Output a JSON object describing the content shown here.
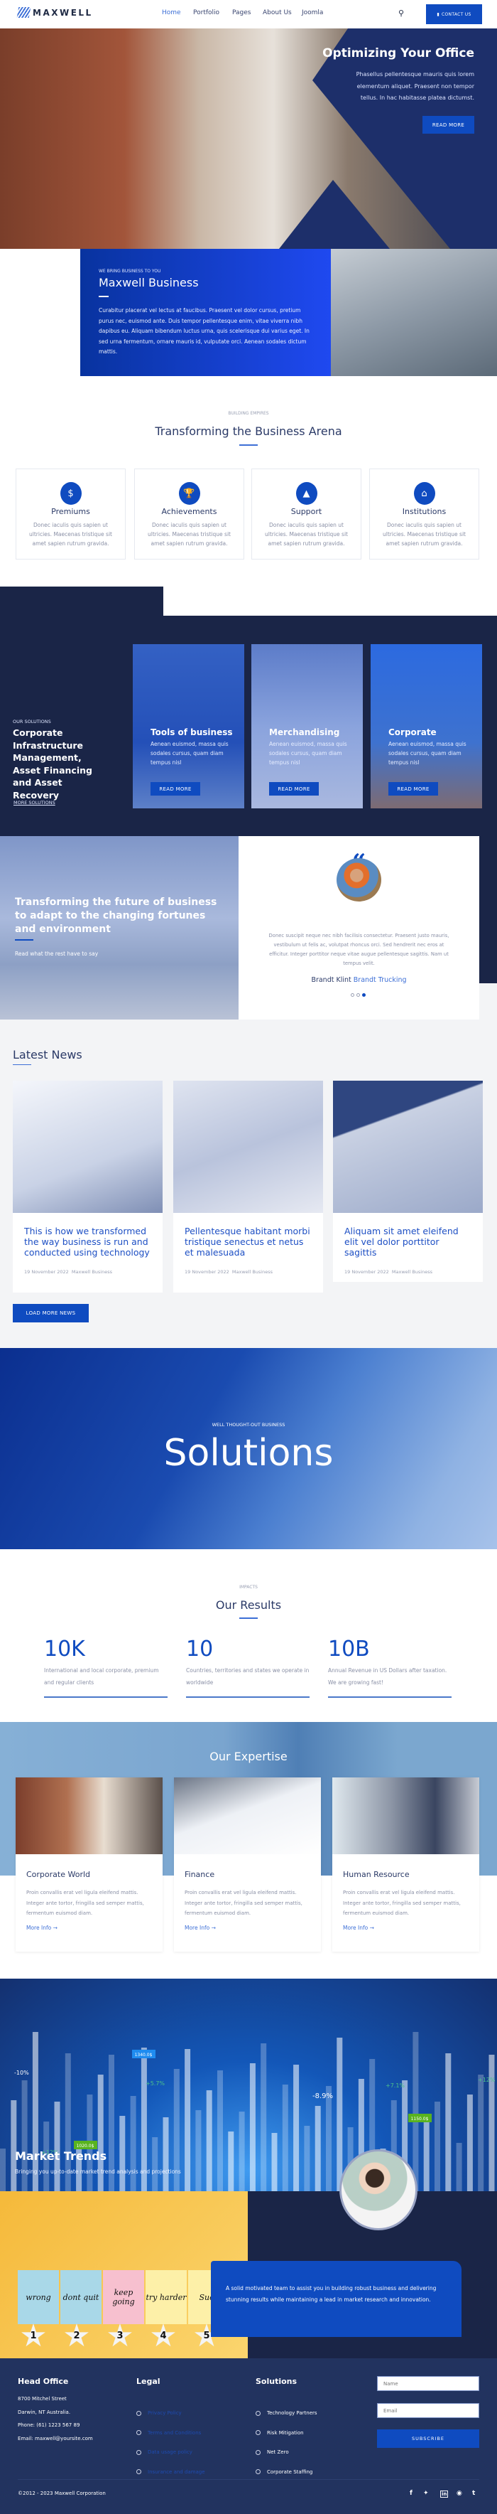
{
  "header": {
    "logo": "MAXWELL",
    "nav": [
      "Home",
      "Portfolio",
      "Pages",
      "About Us",
      "Joomla"
    ],
    "active": "Home",
    "contact_label": "CONTACT US"
  },
  "hero": {
    "title": "Optimizing Your Office",
    "text": "Phasellus pellentesque mauris quis lorem elementum aliquet. Praesent non tempor tellus. In hac habitasse platea dictumst.",
    "button": "READ MORE"
  },
  "intro": {
    "eyebrow": "WE BRING BUSINESS TO YOU",
    "title": "Maxwell Business",
    "text": "Curabitur placerat vel lectus at faucibus. Praesent vel dolor cursus, pretium purus nec, euismod ante. Duis tempor pellentesque enim, vitae viverra nibh dapibus eu. Aliquam bibendum luctus urna, quis scelerisque dui varius eget. In sed urna fermentum, ornare mauris id, vulputate orci. Aenean sodales dictum mattis."
  },
  "features": {
    "eyebrow": "BUILDING EMPIRES",
    "title": "Transforming the Business Arena",
    "items": [
      {
        "icon": "money-chat-icon",
        "title": "Premiums",
        "text": "Donec iaculis quis sapien ut ultricies. Maecenas tristique sit amet sapien rutrum gravida."
      },
      {
        "icon": "trophy-icon",
        "title": "Achievements",
        "text": "Donec iaculis quis sapien ut ultricies. Maecenas tristique sit amet sapien rutrum gravida."
      },
      {
        "icon": "shark-fin-icon",
        "title": "Support",
        "text": "Donec iaculis quis sapien ut ultricies. Maecenas tristique sit amet sapien rutrum gravida."
      },
      {
        "icon": "institution-icon",
        "title": "Institutions",
        "text": "Donec iaculis quis sapien ut ultricies. Maecenas tristique sit amet sapien rutrum gravida."
      }
    ]
  },
  "solutions": {
    "eyebrow": "OUR SOLUTIONS",
    "title": "Corporate Infrastructure Management, Asset Financing and Asset Recovery",
    "more": "MORE SOLUTIONS",
    "cards": [
      {
        "title": "Tools of business",
        "text": "Aenean euismod, massa quis sodales cursus, quam diam tempus nisl",
        "button": "READ MORE"
      },
      {
        "title": "Merchandising",
        "text": "Aenean euismod, massa quis sodales cursus, quam diam tempus nisl",
        "button": "READ MORE"
      },
      {
        "title": "Corporate",
        "text": "Aenean euismod, massa quis sodales cursus, quam diam tempus nisl",
        "button": "READ MORE"
      }
    ]
  },
  "testimonial": {
    "heading": "Transforming the future of business to adapt to the changing fortunes and environment",
    "sub": "Read what the rest have to say",
    "quote": "Donec suscipit neque nec nibh facilisis consectetur. Praesent justo mauris, vestibulum ut felis ac, volutpat rhoncus orci. Sed hendrerit nec eros at efficitur. Integer porttitor neque vitae augue pellentesque sagittis. Nam ut tempus velit.",
    "name": "Brandt Klint",
    "company": "Brandt Trucking",
    "active_slide": 3,
    "slides": 3
  },
  "news": {
    "title": "Latest News",
    "items": [
      {
        "title": "This is how we transformed the way business is run and conducted using technology",
        "date": "19 November 2022",
        "author": "Maxwell Business"
      },
      {
        "title": "Pellentesque habitant morbi tristique senectus et netus et malesuada",
        "date": "19 November 2022",
        "author": "Maxwell Business"
      },
      {
        "title": "Aliquam sit amet eleifend elit vel dolor porttitor sagittis",
        "date": "19 November 2022",
        "author": "Maxwell Business"
      }
    ],
    "load_more": "LOAD MORE NEWS"
  },
  "banner": {
    "eyebrow": "WELL THOUGHT-OUT BUSINESS",
    "title": "Solutions"
  },
  "results": {
    "eyebrow": "IMPACTS",
    "title": "Our Results",
    "stats": [
      {
        "value": "10K",
        "text": "International and local corporate, premium and regular clients"
      },
      {
        "value": "10",
        "text": "Countries, territories and states we operate in worldwide"
      },
      {
        "value": "10B",
        "text": "Annual Revenue in US Dollars after taxation. We are growing fast!"
      }
    ]
  },
  "expertise": {
    "title": "Our Expertise",
    "items": [
      {
        "title": "Corporate World",
        "text": "Proin convallis erat vel ligula eleifend mattis. Integer ante tortor, fringilla sed semper mattis, fermentum euismod diam.",
        "link": "More Info"
      },
      {
        "title": "Finance",
        "text": "Proin convallis erat vel ligula eleifend mattis. Integer ante tortor, fringilla sed semper mattis, fermentum euismod diam.",
        "link": "More Info"
      },
      {
        "title": "Human Resource",
        "text": "Proin convallis erat vel ligula eleifend mattis. Integer ante tortor, fringilla sed semper mattis, fermentum euismod diam.",
        "link": "More Info"
      }
    ]
  },
  "market": {
    "title": "Market Trends",
    "text": "Bringing you up-to-date market trend analysis and projections",
    "image_labels": [
      "1340.0$",
      "1020.0$",
      "1150.0$",
      "+5.7%",
      "+12%",
      "-8.9%",
      "+7.1%",
      "-10%",
      "+12%"
    ],
    "notes": [
      "wrong",
      "dont quit",
      "keep going",
      "try harder",
      "Succ"
    ],
    "stars": [
      "1",
      "2",
      "3",
      "4",
      "5"
    ],
    "callout": "A solid motivated team to assist you in building robust business and delivering stunning results while maintaining a lead in market research and innovation."
  },
  "footer": {
    "office": {
      "title": "Head Office",
      "lines": [
        "8700 Mitchel Street",
        "Darwin, NT Australia.",
        "Phone: (61) 1223 567 89",
        "Email: maxwell@yoursite.com"
      ]
    },
    "legal": {
      "title": "Legal",
      "links": [
        "Privacy Policy",
        "Terms and Conditions",
        "Data usage policy",
        "Insurance and damage"
      ]
    },
    "solutions": {
      "title": "Solutions",
      "links": [
        "Technology Partners",
        "Risk Mitigation",
        "Net Zero",
        "Corporate Staffing"
      ]
    },
    "form": {
      "name_placeholder": "Name",
      "email_placeholder": "Email",
      "subscribe": "SUBSCRIBE"
    },
    "copyright": "©2012 - 2023 Maxwell Corporation",
    "social": [
      "facebook-icon",
      "twitter-icon",
      "linkedin-icon",
      "pinterest-icon",
      "tumblr-icon"
    ]
  },
  "colors": {
    "accent": "#0f4bc0",
    "navy": "#1a2547",
    "footer": "#22335f",
    "hero_navy": "#1d2f6a",
    "expertise_bg": "#7ba7cf",
    "market_yellow": "#f7c44f"
  }
}
